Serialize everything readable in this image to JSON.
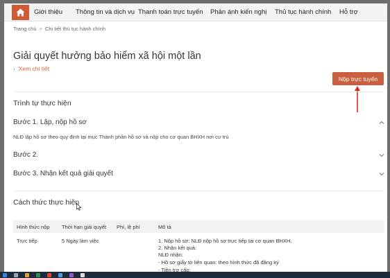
{
  "nav": {
    "items": [
      {
        "label": "Giới thiệu"
      },
      {
        "label": "Thông tin và dịch vụ"
      },
      {
        "label": "Thanh toán trực tuyến"
      },
      {
        "label": "Phản ánh kiến nghị"
      },
      {
        "label": "Thủ tục hành chính"
      },
      {
        "label": "Hỗ trợ"
      }
    ],
    "home_icon": "home-icon",
    "accent": "#cf5a36"
  },
  "breadcrumb": {
    "home": "Trang chủ",
    "separator": ">",
    "current": "Chi tiết thủ tục hành chính"
  },
  "page": {
    "title": "Giải quyết hưởng bảo hiểm xã hội một lần",
    "detail_link": "Xem chi tiết",
    "submit_label": "Nộp trực tuyến",
    "submit_color": "#c8603f"
  },
  "procedure": {
    "heading": "Trình tự thực hiện",
    "steps": [
      {
        "label": "Bước 1. Lập, nộp hồ sơ",
        "expanded": true,
        "description": "NLĐ lập hồ sơ theo quy định tại mục Thành phần hồ sơ và nộp cho cơ quan BHXH nơi cư trú"
      },
      {
        "label": "Bước 2.",
        "expanded": false
      },
      {
        "label": "Bước 3. Nhận kết quả giải quyết",
        "expanded": false
      }
    ]
  },
  "method": {
    "heading": "Cách thức thực hiện",
    "columns": [
      "Hình thức nộp",
      "Thời hạn giải quyết",
      "Phí, lệ phí",
      "Mô tả"
    ],
    "rows": [
      {
        "form": "Trực tiếp",
        "deadline": "5 Ngày làm việc",
        "fee": "",
        "description": [
          "1. Nộp hồ sơ: NLĐ nộp hồ sơ trực tiếp tại cơ quan BHXH.",
          "2. Nhận kết quả:",
          "NLĐ nhận:",
          "- Hồ sơ giấy tờ liên quan: theo hình thức đã đăng ký",
          "- Tiền trợ cấp:"
        ]
      }
    ]
  }
}
